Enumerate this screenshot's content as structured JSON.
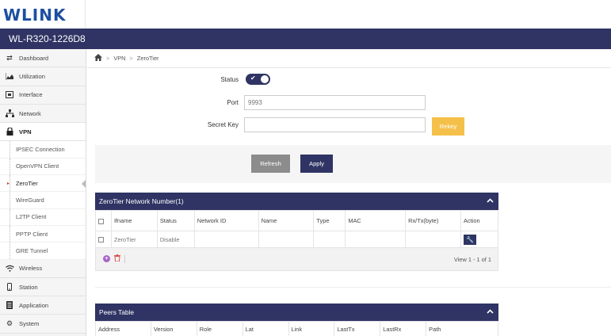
{
  "brand": {
    "logo": "WLINK"
  },
  "device": {
    "name": "WL-R320-1226D8"
  },
  "sidebar": {
    "items": [
      {
        "label": "Dashboard",
        "icon": "exchange-icon"
      },
      {
        "label": "Utilization",
        "icon": "chart-icon"
      },
      {
        "label": "Interface",
        "icon": "interface-icon"
      },
      {
        "label": "Network",
        "icon": "network-icon"
      },
      {
        "label": "VPN",
        "icon": "lock-icon"
      }
    ],
    "vpn_sub": [
      {
        "label": "IPSEC Connection"
      },
      {
        "label": "OpenVPN Client"
      },
      {
        "label": "ZeroTier"
      },
      {
        "label": "WireGuard"
      },
      {
        "label": "L2TP Client"
      },
      {
        "label": "PPTP Client"
      },
      {
        "label": "GRE Tunnel"
      }
    ],
    "bottom": [
      {
        "label": "Wireless",
        "icon": "wifi-icon"
      },
      {
        "label": "Station",
        "icon": "phone-icon"
      },
      {
        "label": "Application",
        "icon": "application-icon"
      },
      {
        "label": "System",
        "icon": "gears-icon"
      }
    ]
  },
  "breadcrumb": {
    "home_icon": "home-icon",
    "sep": ">",
    "level1": "VPN",
    "level2": "ZeroTier"
  },
  "form": {
    "status_label": "Status",
    "status_on": true,
    "port_label": "Port",
    "port_placeholder": "9993",
    "secret_label": "Secret Key",
    "secret_value": "",
    "rekey_label": "Rekey"
  },
  "buttons": {
    "refresh": "Refresh",
    "apply": "Apply"
  },
  "network_table": {
    "title": "ZeroTier Network Number(1)",
    "columns": [
      "Ifname",
      "Status",
      "Network ID",
      "Name",
      "Type",
      "MAC",
      "Rx/Tx(byte)",
      "Action"
    ],
    "rows": [
      {
        "ifname": "ZeroTier",
        "status": "Disable",
        "network_id": "",
        "name": "",
        "type": "",
        "mac": "",
        "rxtx": ""
      }
    ],
    "pager": "View 1 - 1 of 1"
  },
  "peers_table": {
    "title": "Peers Table",
    "columns": [
      "Address",
      "Version",
      "Role",
      "Lat",
      "Link",
      "LastTx",
      "LastRx",
      "Path"
    ]
  },
  "colors": {
    "primary": "#2f3464",
    "accent": "#f5c04a",
    "logo": "#1d4fa0"
  }
}
